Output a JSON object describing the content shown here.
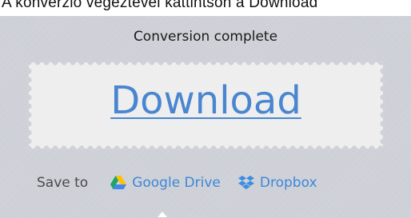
{
  "header": {
    "clipped_text": "A konverzió végeztével kattintson a Download"
  },
  "panel": {
    "status_text": "Conversion complete",
    "download_label": "Download",
    "save_to_label": "Save to",
    "services": [
      {
        "label": "Google Drive",
        "icon": "google-drive-icon"
      },
      {
        "label": "Dropbox",
        "icon": "dropbox-icon"
      }
    ]
  },
  "colors": {
    "link": "#4a86d0",
    "panel_bg": "#cfd2d8",
    "ticket_bg": "#efefef"
  }
}
